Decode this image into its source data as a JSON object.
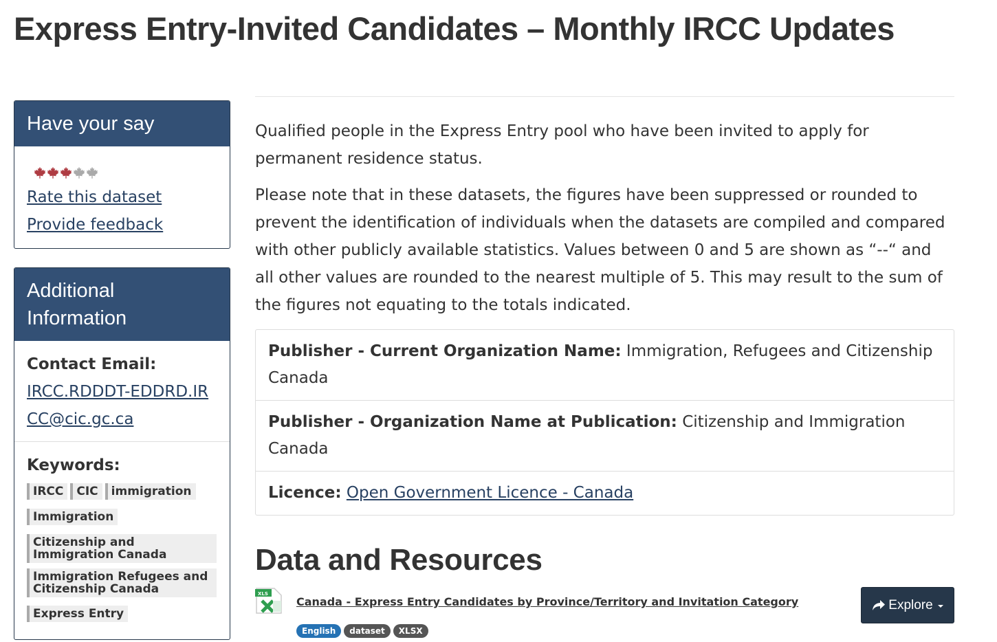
{
  "page": {
    "title": "Express Entry-Invited Candidates – Monthly IRCC Updates"
  },
  "have_your_say": {
    "heading": "Have your say",
    "rating": {
      "value": 3,
      "max": 5,
      "icon": "maple-leaf-icon",
      "filled_color": "#af3c43",
      "empty_color": "#aaaaaa"
    },
    "rate_link": "Rate this dataset",
    "feedback_link": "Provide feedback"
  },
  "additional_info": {
    "heading": "Additional Information",
    "contact_label": "Contact Email:",
    "contact_email": "IRCC.RDDDT-EDDRD.IRCC@cic.gc.ca",
    "keywords_label": "Keywords:",
    "keywords": [
      "IRCC",
      "CIC",
      "immigration",
      "Immigration",
      "Citizenship and Immigration Canada",
      "Immigration Refugees and Citizenship Canada",
      "Express Entry"
    ]
  },
  "description": {
    "paragraph1": "Qualified people in the Express Entry pool who have been invited to apply for permanent residence status.",
    "paragraph2": "Please note that in these datasets, the figures have been suppressed or rounded to prevent the identification of individuals when the datasets are compiled and compared with other publicly available statistics. Values between 0 and 5 are shown as “--“ and all other values are rounded to the nearest multiple of 5. This may result to the sum of the figures not equating to the totals indicated."
  },
  "metadata": {
    "current_org_label": "Publisher - Current Organization Name:",
    "current_org_value": "Immigration, Refugees and Citizenship Canada",
    "pub_org_label": "Publisher - Organization Name at Publication:",
    "pub_org_value": "Citizenship and Immigration Canada",
    "licence_label": "Licence:",
    "licence_value": "Open Government Licence - Canada"
  },
  "resources": {
    "heading": "Data and Resources",
    "items": [
      {
        "title": "Canada - Express Entry Candidates by Province/Territory and Invitation Category",
        "file_icon": "xls-file-icon",
        "badges": [
          "English",
          "dataset",
          "XLSX"
        ],
        "explore_label": "Explore"
      }
    ]
  },
  "colors": {
    "panel_heading_bg": "#335075",
    "button_bg": "#26374a",
    "link": "#284162",
    "badge_language": "#2572b4",
    "badge_default": "#555555"
  }
}
